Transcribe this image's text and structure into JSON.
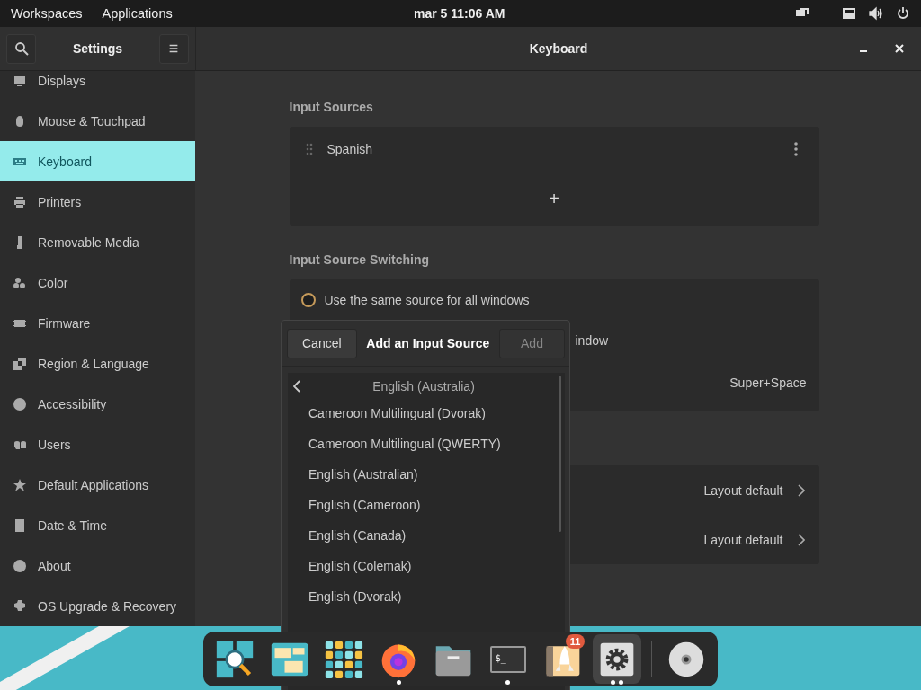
{
  "top_bar": {
    "left": [
      "Workspaces",
      "Applications"
    ],
    "clock": "mar 5  11:06 AM"
  },
  "sidebar": {
    "title": "Settings",
    "items": [
      {
        "label": "Displays",
        "selected": false
      },
      {
        "label": "Mouse & Touchpad",
        "selected": false
      },
      {
        "label": "Keyboard",
        "selected": true
      },
      {
        "label": "Printers",
        "selected": false
      },
      {
        "label": "Removable Media",
        "selected": false
      },
      {
        "label": "Color",
        "selected": false
      },
      {
        "label": "Firmware",
        "selected": false
      },
      {
        "label": "Region & Language",
        "selected": false
      },
      {
        "label": "Accessibility",
        "selected": false
      },
      {
        "label": "Users",
        "selected": false
      },
      {
        "label": "Default Applications",
        "selected": false
      },
      {
        "label": "Date & Time",
        "selected": false
      },
      {
        "label": "About",
        "selected": false
      },
      {
        "label": "OS Upgrade & Recovery",
        "selected": false
      }
    ]
  },
  "window": {
    "title": "Keyboard"
  },
  "input_sources": {
    "heading": "Input Sources",
    "sources": [
      "Spanish"
    ],
    "add": "+"
  },
  "switching": {
    "heading": "Input Source Switching",
    "options": [
      {
        "label": "Use the same source for all windows",
        "selected": false
      },
      {
        "label": "indow"
      }
    ],
    "shortcut": "Super+Space"
  },
  "layout_rows": [
    {
      "value": "Layout default"
    },
    {
      "value": "Layout default"
    }
  ],
  "dialog": {
    "cancel": "Cancel",
    "title": "Add an Input Source",
    "add": "Add",
    "add_disabled": true,
    "language": "English (Australia)",
    "layouts": [
      "Cameroon Multilingual (Dvorak)",
      "Cameroon Multilingual (QWERTY)",
      "English (Australian)",
      "English (Cameroon)",
      "English (Canada)",
      "English (Colemak)",
      "English (Dvorak)"
    ]
  },
  "dock": {
    "items": [
      {
        "kind": "search",
        "running": false,
        "selected": false
      },
      {
        "kind": "workspaces",
        "running": false,
        "selected": false
      },
      {
        "kind": "grid",
        "running": false,
        "selected": false
      },
      {
        "kind": "browser",
        "running": true,
        "selected": false
      },
      {
        "kind": "folder",
        "running": false,
        "selected": false
      },
      {
        "kind": "terminal",
        "running": true,
        "selected": false,
        "text": "$_"
      },
      {
        "kind": "rocket",
        "running": false,
        "selected": false,
        "badge": "11"
      },
      {
        "kind": "gear",
        "running": true,
        "selected": true
      },
      {
        "kind": "separator"
      },
      {
        "kind": "disc",
        "running": false,
        "selected": false
      }
    ]
  }
}
